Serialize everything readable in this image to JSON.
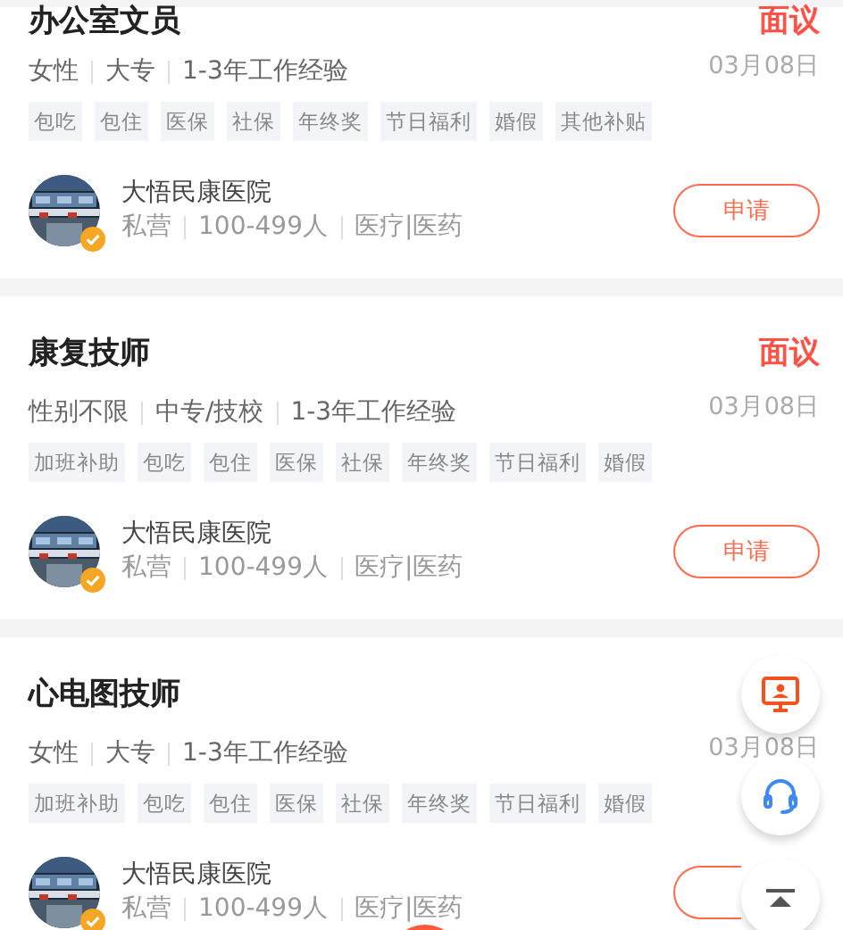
{
  "jobs": [
    {
      "title": "办公室文员",
      "salary": "面议",
      "requirements": [
        "女性",
        "大专",
        "1-3年工作经验"
      ],
      "date": "03月08日",
      "tags": [
        "包吃",
        "包住",
        "医保",
        "社保",
        "年终奖",
        "节日福利",
        "婚假",
        "其他补贴"
      ],
      "company": {
        "name": "大悟民康医院",
        "verified": true,
        "details": [
          "私营",
          "100-499人",
          "医疗|医药"
        ]
      },
      "apply": {
        "label": "申请"
      }
    },
    {
      "title": "康复技师",
      "salary": "面议",
      "requirements": [
        "性别不限",
        "中专/技校",
        "1-3年工作经验"
      ],
      "date": "03月08日",
      "tags": [
        "加班补助",
        "包吃",
        "包住",
        "医保",
        "社保",
        "年终奖",
        "节日福利",
        "婚假"
      ],
      "company": {
        "name": "大悟民康医院",
        "verified": true,
        "details": [
          "私营",
          "100-499人",
          "医疗|医药"
        ]
      },
      "apply": {
        "label": "申请"
      }
    },
    {
      "title": "心电图技师",
      "requirements": [
        "女性",
        "大专",
        "1-3年工作经验"
      ],
      "date": "03月08日",
      "tags": [
        "加班补助",
        "包吃",
        "包住",
        "医保",
        "社保",
        "年终奖",
        "节日福利",
        "婚假"
      ],
      "company": {
        "name": "大悟民康医院",
        "verified": true,
        "details": [
          "私营",
          "100-499人",
          "医疗|医药"
        ]
      },
      "apply": {
        "covered": true
      }
    }
  ],
  "floating_buttons": [
    {
      "kind": "screen"
    },
    {
      "kind": "support"
    },
    {
      "kind": "top"
    }
  ],
  "bottom_button": {
    "kind": "partial"
  }
}
